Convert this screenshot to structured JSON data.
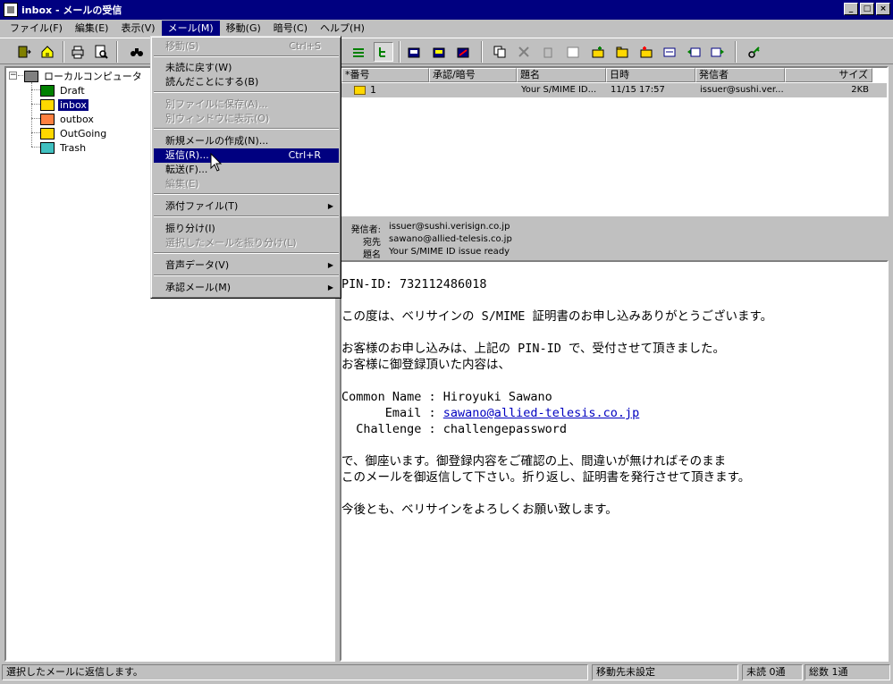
{
  "window": {
    "title": "inbox - メールの受信",
    "buttons": [
      "_",
      "□",
      "×"
    ]
  },
  "menubar": [
    {
      "label": "ファイル(F)"
    },
    {
      "label": "編集(E)"
    },
    {
      "label": "表示(V)"
    },
    {
      "label": "メール(M)",
      "active": true
    },
    {
      "label": "移動(G)"
    },
    {
      "label": "暗号(C)"
    },
    {
      "label": "ヘルプ(H)"
    }
  ],
  "menu": {
    "move": {
      "label": "移動(S)",
      "shortcut": "Ctrl+S"
    },
    "mark_unread": {
      "label": "未読に戻す(W)"
    },
    "mark_read": {
      "label": "読んだことにする(B)"
    },
    "save_file": {
      "label": "別ファイルに保存(A)..."
    },
    "show_window": {
      "label": "別ウィンドウに表示(O)"
    },
    "new_mail": {
      "label": "新規メールの作成(N)..."
    },
    "reply": {
      "label": "返信(R)...",
      "shortcut": "Ctrl+R"
    },
    "forward": {
      "label": "転送(F)..."
    },
    "edit": {
      "label": "編集(E)"
    },
    "attach": {
      "label": "添付ファイル(T)"
    },
    "sort": {
      "label": "振り分け(I)"
    },
    "sort_selected": {
      "label": "選択したメールを振り分け(L)"
    },
    "voice": {
      "label": "音声データ(V)"
    },
    "approval": {
      "label": "承認メール(M)"
    }
  },
  "tree": {
    "root": "ローカルコンピュータ",
    "folders": [
      {
        "label": "Draft",
        "icon": "draft-folder-icon"
      },
      {
        "label": "inbox",
        "icon": "inbox-folder-icon",
        "selected": true
      },
      {
        "label": "outbox",
        "icon": "outbox-folder-icon"
      },
      {
        "label": "OutGoing",
        "icon": "outgoing-folder-icon"
      },
      {
        "label": "Trash",
        "icon": "trash-icon"
      }
    ]
  },
  "list": {
    "columns": [
      "*番号",
      "承認/暗号",
      "題名",
      "日時",
      "発信者",
      "サイズ"
    ],
    "rows": [
      {
        "number": "1",
        "approval": "",
        "subject": "Your S/MIME ID...",
        "date": "11/15 17:57",
        "sender": "issuer@sushi.ver...",
        "size": "2KB"
      }
    ]
  },
  "header": {
    "from_label": "発信者:",
    "from": "issuer@sushi.verisign.co.jp",
    "to_label": "宛先",
    "to": "sawano@allied-telesis.co.jp",
    "subject_label": "題名",
    "subject": "Your S/MIME ID issue ready"
  },
  "body": {
    "pin": "PIN-ID: 732112486018",
    "p1": "この度は、ベリサインの S/MIME 証明書のお申し込みありがとうございます。",
    "p2a": "お客様のお申し込みは、上記の PIN-ID で、受付させて頂きました。",
    "p2b": "お客様に御登録頂いた内容は、",
    "common_name": "Common Name : Hiroyuki Sawano",
    "email_label": "      Email : ",
    "email": "sawano@allied-telesis.co.jp",
    "challenge": "  Challenge : challengepassword",
    "p3a": "で、御座います。御登録内容をご確認の上、間違いが無ければそのまま",
    "p3b": "このメールを御返信して下さい。折り返し、証明書を発行させて頂きます。",
    "p4": "今後とも、ベリサインをよろしくお願い致します。"
  },
  "status": {
    "hint": "選択したメールに返信します。",
    "dest": "移動先未設定",
    "unread": "未読 0通",
    "total": "総数 1通"
  },
  "colors": {
    "title_bar": "#000080",
    "face": "#c0c0c0",
    "highlight": "#000080",
    "link": "#0000c0"
  }
}
